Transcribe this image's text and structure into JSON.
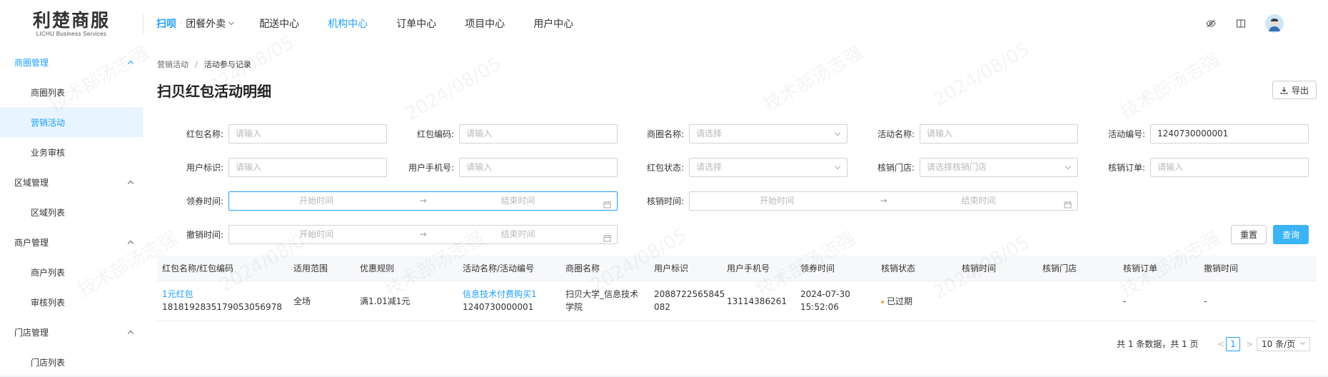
{
  "header": {
    "logo_main": "利楚商服",
    "logo_sub": "LICHU Business Services",
    "nav_scan": "扫呗",
    "nav_dot": "·",
    "nav_items": [
      {
        "label": "团餐外卖"
      },
      {
        "label": "配送中心"
      },
      {
        "label": "机构中心"
      },
      {
        "label": "订单中心"
      },
      {
        "label": "项目中心"
      },
      {
        "label": "用户中心"
      }
    ]
  },
  "sidebar": {
    "groups": [
      {
        "label": "商圈管理",
        "items": [
          "商圈列表",
          "营销活动",
          "业务审核"
        ]
      },
      {
        "label": "区域管理",
        "items": [
          "区域列表"
        ]
      },
      {
        "label": "商户管理",
        "items": [
          "商户列表",
          "审核列表"
        ]
      },
      {
        "label": "门店管理",
        "items": [
          "门店列表"
        ]
      }
    ]
  },
  "breadcrumb": {
    "parent": "营销活动",
    "sep": "/",
    "current": "活动参与记录"
  },
  "page_title": "扫贝红包活动明细",
  "export_label": "导出",
  "filters": {
    "redpack_name": {
      "label": "红包名称:",
      "placeholder": "请输入"
    },
    "redpack_code": {
      "label": "红包编码:",
      "placeholder": "请输入"
    },
    "district_name": {
      "label": "商圈名称:",
      "placeholder": "请选择"
    },
    "activity_name": {
      "label": "活动名称:",
      "placeholder": "请输入"
    },
    "activity_no": {
      "label": "活动编号:",
      "value": "1240730000001"
    },
    "user_id": {
      "label": "用户标识:",
      "placeholder": "请输入"
    },
    "user_phone": {
      "label": "用户手机号:",
      "placeholder": "请输入"
    },
    "redpack_status": {
      "label": "红包状态:",
      "placeholder": "请选择"
    },
    "verify_store": {
      "label": "核销门店:",
      "placeholder": "请选择核销门店"
    },
    "verify_order": {
      "label": "核销订单:",
      "placeholder": "请输入"
    },
    "claim_time": {
      "label": "领券时间:",
      "start": "开始时间",
      "arrow": "→",
      "end": "结束时间"
    },
    "verify_time": {
      "label": "核销时间:",
      "start": "开始时间",
      "arrow": "→",
      "end": "结束时间"
    },
    "cancel_time": {
      "label": "撤销时间:",
      "start": "开始时间",
      "arrow": "→",
      "end": "结束时间"
    }
  },
  "buttons": {
    "reset": "重置",
    "query": "查询"
  },
  "table": {
    "columns": [
      "红包名称/红包编码",
      "适用范围",
      "优惠规则",
      "活动名称/活动编号",
      "商圈名称",
      "用户标识",
      "用户手机号",
      "领券时间",
      "核销状态",
      "核销时间",
      "核销门店",
      "核销订单",
      "撤销时间"
    ],
    "rows": [
      {
        "redpack_name": "1元红包",
        "redpack_code": "1818192835179053056978",
        "scope": "全场",
        "rule": "满1.01减1元",
        "activity_name": "信息技术付费购买1",
        "activity_no": "1240730000001",
        "district_1": "扫贝大学_信息技术",
        "district_2": "学院",
        "user_id_1": "2088722565845",
        "user_id_2": "082",
        "phone": "13114386261",
        "claim_date": "2024-07-30",
        "claim_clock": "15:52:06",
        "status": "已过期",
        "verify_time": "",
        "verify_store": "",
        "verify_order": "-",
        "cancel_time": "-"
      }
    ]
  },
  "pagination": {
    "summary": "共 1 条数据，共 1 页",
    "prev": "<",
    "page": "1",
    "next": ">",
    "size": "10 条/页"
  },
  "watermark": {
    "name": "技术部汤志强",
    "date": "2024/08/05"
  }
}
